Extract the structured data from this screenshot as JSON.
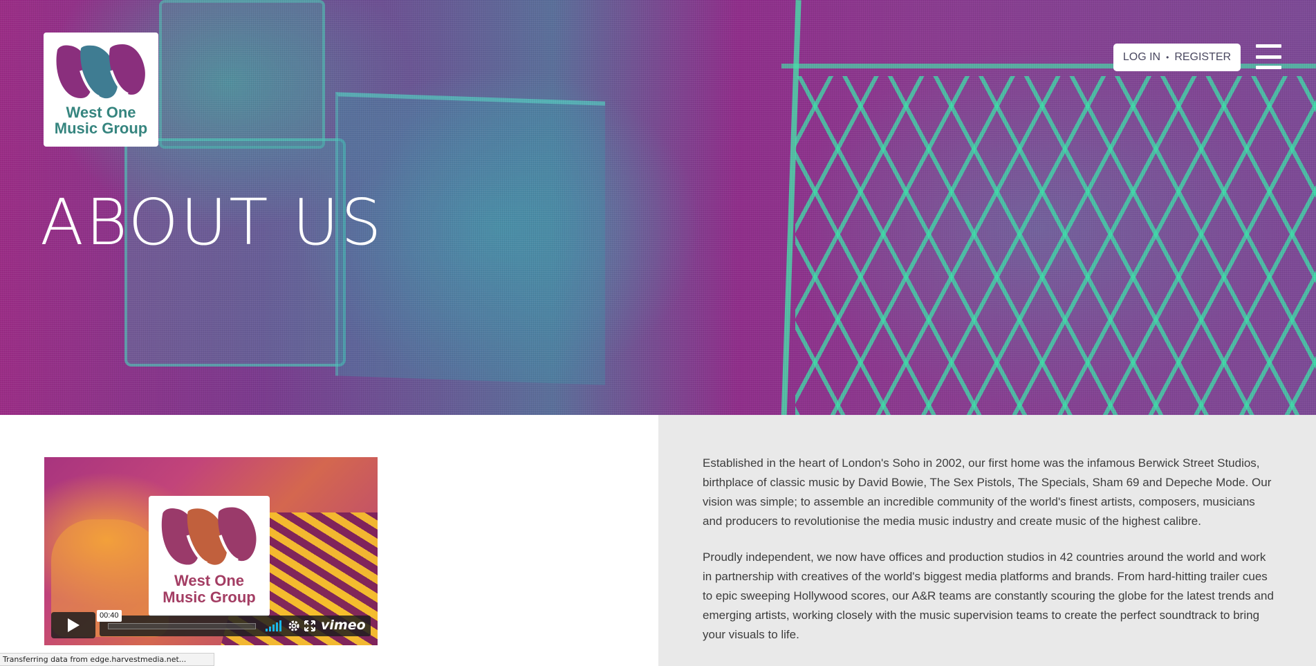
{
  "brand": {
    "name_line1": "West One",
    "name_line2": "Music Group",
    "logo_colors": {
      "mark": "#8a2f7d",
      "text": "#36857f"
    }
  },
  "header": {
    "login_label": "LOG IN",
    "separator": "•",
    "register_label": "REGISTER",
    "menu_icon": "hamburger-icon"
  },
  "hero": {
    "title": "ABOUT US"
  },
  "video": {
    "logo_line1": "West One",
    "logo_line2": "Music Group",
    "time": "00:40",
    "provider": "vimeo",
    "icons": [
      "play-icon",
      "volume-icon",
      "gear-icon",
      "fullscreen-icon"
    ]
  },
  "about": {
    "paragraph1": "Established in the heart of London's Soho in 2002, our first home was the infamous Berwick Street Studios, birthplace of classic music by David Bowie, The Sex Pistols, The Specials, Sham 69 and Depeche Mode. Our vision was simple; to assemble an incredible community of the world's finest artists, composers, musicians and producers to revolutionise the media music industry and create music of the highest calibre.",
    "paragraph2": "Proudly independent, we now have offices and production studios in 42 countries around the world and work in partnership with creatives of the world's biggest media platforms and brands. From hard-hitting trailer cues to epic sweeping Hollywood scores, our A&R teams are constantly scouring the globe for the latest trends and emerging artists, working closely with the music supervision teams to create the perfect soundtrack to bring your visuals to life."
  },
  "status_bar": {
    "text": "Transferring data from edge.harvestmedia.net..."
  },
  "colors": {
    "panel_bg": "#e9e9e9",
    "body_text": "#3d3d3d",
    "hero_magenta": "#9b2c86",
    "hero_teal": "#3cd2aa",
    "vimeo_blue": "#19b7ea"
  }
}
